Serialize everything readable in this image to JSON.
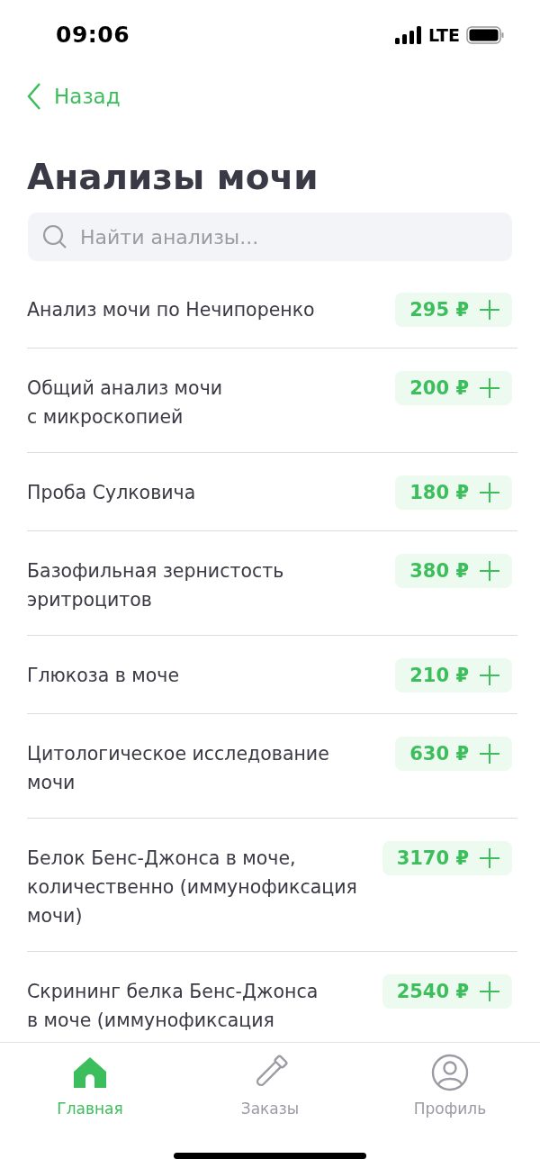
{
  "status_bar": {
    "time": "09:06",
    "network": "LTE"
  },
  "back": {
    "label": "Назад"
  },
  "title": "Анализы мочи",
  "search": {
    "placeholder": "Найти анализы..."
  },
  "tests": [
    {
      "name": "Анализ мочи по Нечипоренко",
      "price": "295 ₽"
    },
    {
      "name": "Общий анализ мочи\nс микроскопией",
      "price": "200 ₽"
    },
    {
      "name": "Проба Сулковича",
      "price": "180 ₽"
    },
    {
      "name": "Базофильная зернистость\nэритроцитов",
      "price": "380 ₽"
    },
    {
      "name": "Глюкоза в моче",
      "price": "210 ₽"
    },
    {
      "name": "Цитологическое исследование\nмочи",
      "price": "630 ₽"
    },
    {
      "name": "Белок Бенс-Джонса в моче,\nколичественно (иммунофиксация\nмочи)",
      "price": "3170 ₽"
    },
    {
      "name": "Скрининг белка Бенс-Джонса\nв моче (иммунофиксация",
      "price": "2540 ₽"
    }
  ],
  "tab_bar": [
    {
      "kind": "home",
      "label": "Главная",
      "selected": true
    },
    {
      "kind": "orders",
      "label": "Заказы",
      "selected": false
    },
    {
      "kind": "profile",
      "label": "Профиль",
      "selected": false
    }
  ]
}
